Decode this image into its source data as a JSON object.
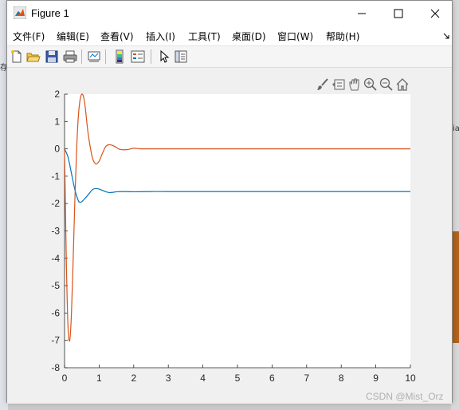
{
  "window": {
    "title": "Figure 1"
  },
  "menu": [
    {
      "label": "文件(F)"
    },
    {
      "label": "编辑(E)"
    },
    {
      "label": "查看(V)"
    },
    {
      "label": "插入(I)"
    },
    {
      "label": "工具(T)"
    },
    {
      "label": "桌面(D)"
    },
    {
      "label": "窗口(W)"
    },
    {
      "label": "帮助(H)"
    }
  ],
  "toolbar_icons": [
    "new-figure-icon",
    "open-file-icon",
    "save-icon",
    "print-icon",
    "link-plot-icon",
    "colorbar-icon",
    "legend-icon",
    "edit-plot-icon",
    "property-editor-icon"
  ],
  "axes_toolbar_icons": [
    "brush-icon",
    "data-tips-icon",
    "pan-icon",
    "zoom-in-icon",
    "zoom-out-icon",
    "home-icon"
  ],
  "watermark": "CSDN @Mist_Orz",
  "stubs": {
    "left": "存",
    "right": "ia"
  },
  "colors": {
    "series1": "#0072BD",
    "series2": "#D95319"
  },
  "chart_data": {
    "type": "line",
    "title": "",
    "xlabel": "",
    "ylabel": "",
    "xlim": [
      0,
      10
    ],
    "ylim": [
      -8,
      2
    ],
    "xticks": [
      "0",
      "1",
      "2",
      "3",
      "4",
      "5",
      "6",
      "7",
      "8",
      "9",
      "10"
    ],
    "yticks": [
      "2",
      "1",
      "0",
      "-1",
      "-2",
      "-3",
      "-4",
      "-5",
      "-6",
      "-7",
      "-8"
    ],
    "series": [
      {
        "color": "#0072BD",
        "x": [
          0,
          0.1,
          0.2,
          0.3,
          0.4,
          0.45,
          0.5,
          0.6,
          0.7,
          0.8,
          0.9,
          1.0,
          1.1,
          1.2,
          1.3,
          1.4,
          1.5,
          1.7,
          2.0,
          2.5,
          3,
          4,
          5,
          6,
          7,
          8,
          9,
          10
        ],
        "y": [
          0,
          -0.3,
          -0.9,
          -1.5,
          -1.9,
          -1.95,
          -1.93,
          -1.8,
          -1.65,
          -1.5,
          -1.45,
          -1.47,
          -1.52,
          -1.57,
          -1.6,
          -1.59,
          -1.57,
          -1.56,
          -1.57,
          -1.56,
          -1.56,
          -1.56,
          -1.56,
          -1.56,
          -1.56,
          -1.56,
          -1.56,
          -1.56
        ]
      },
      {
        "color": "#D95319",
        "x": [
          0,
          0.05,
          0.1,
          0.15,
          0.2,
          0.25,
          0.3,
          0.35,
          0.4,
          0.45,
          0.5,
          0.55,
          0.6,
          0.65,
          0.7,
          0.8,
          0.9,
          1.0,
          1.1,
          1.2,
          1.3,
          1.4,
          1.5,
          1.6,
          1.8,
          2.0,
          2.2,
          2.5,
          3,
          4,
          5,
          6,
          7,
          8,
          9,
          10
        ],
        "y": [
          0,
          -4.0,
          -6.5,
          -7.0,
          -6.0,
          -4.0,
          -1.8,
          0.0,
          1.2,
          1.8,
          2.0,
          1.9,
          1.5,
          0.9,
          0.4,
          -0.3,
          -0.55,
          -0.45,
          -0.15,
          0.1,
          0.15,
          0.12,
          0.05,
          -0.02,
          -0.03,
          0.02,
          0.0,
          0.0,
          0.0,
          0.0,
          0.0,
          0.0,
          0.0,
          0.0,
          0.0,
          0.0
        ]
      }
    ]
  }
}
